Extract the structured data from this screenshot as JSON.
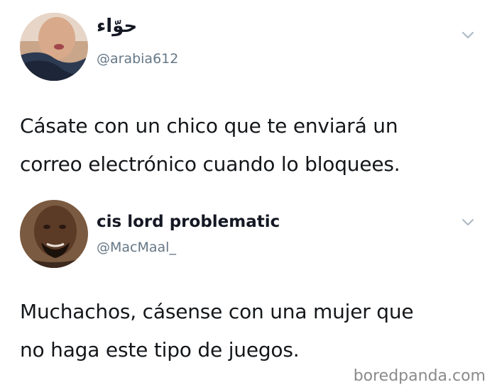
{
  "tweets": [
    {
      "display_name": "حوّاء",
      "handle": "@arabia612",
      "text_lines": [
        "Cásate con un chico que te enviará un",
        "correo electrónico cuando lo bloquees."
      ]
    },
    {
      "display_name": "cis lord problematic",
      "handle": "@MacMaal_",
      "text_lines": [
        "Muchachos, cásense con una mujer que",
        "no haga este tipo de juegos."
      ]
    }
  ],
  "watermark": "boredpanda.com",
  "colors": {
    "handle": "#657786",
    "chevron": "#aab8c2",
    "text": "#14171a",
    "watermark": "#8a8a8a"
  },
  "icons": {
    "tweet_menu": "chevron-down-icon",
    "avatar": "avatar-photo"
  }
}
